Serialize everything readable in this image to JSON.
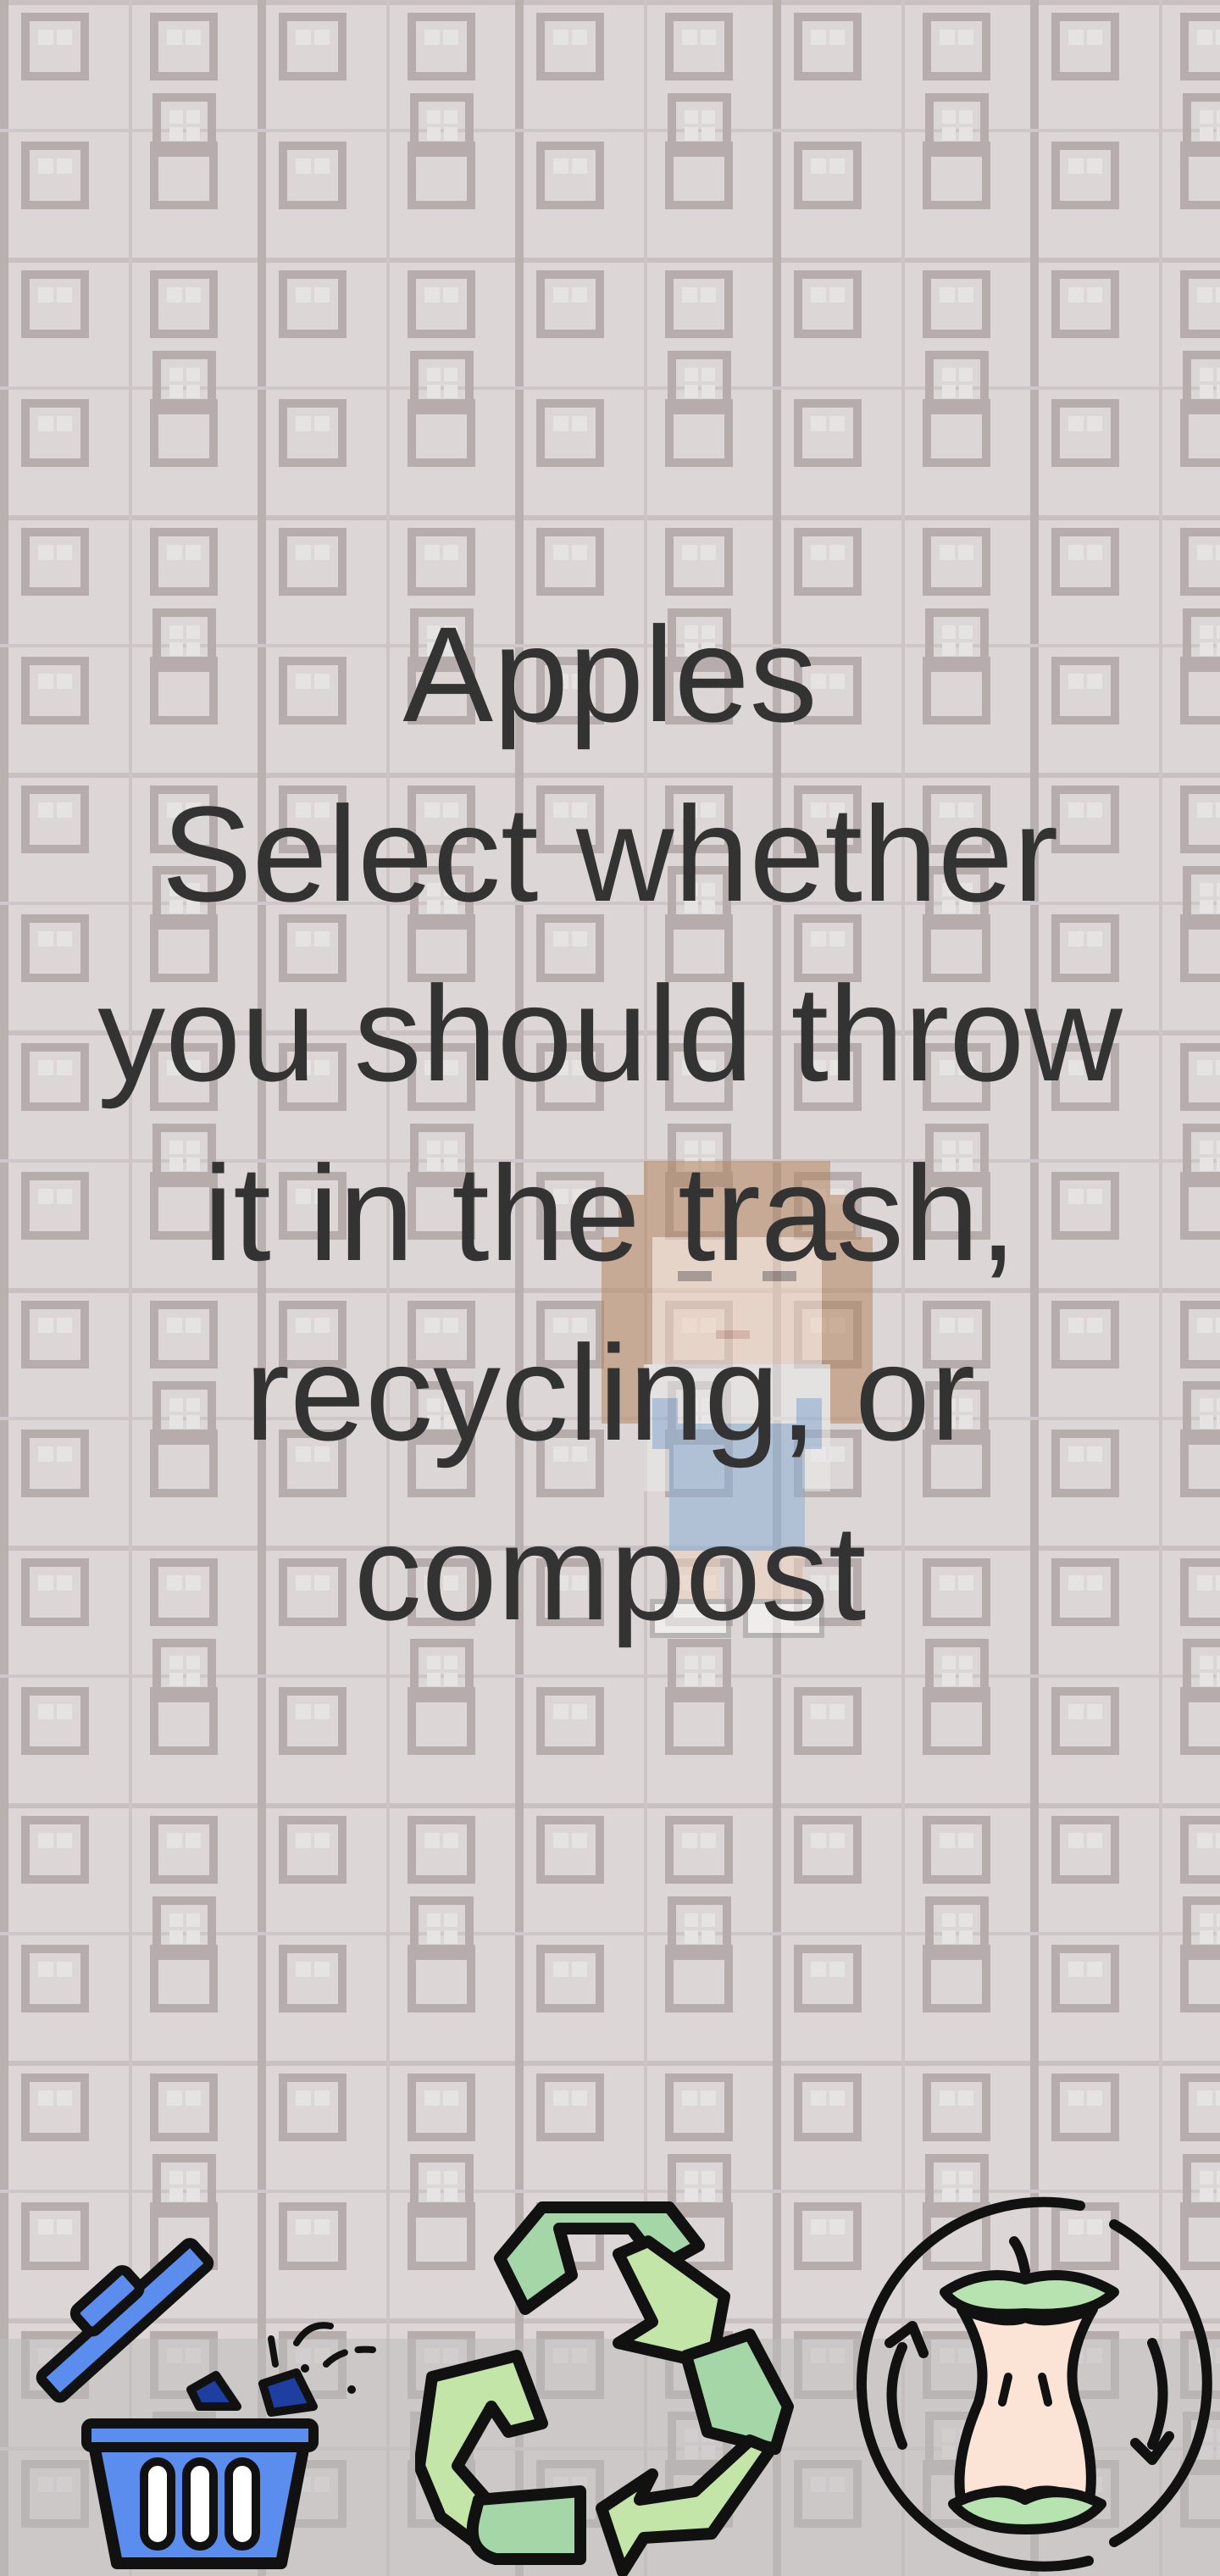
{
  "prompt": {
    "item_name": "Apples",
    "instruction_lines": [
      "Select whether",
      "you should throw",
      "it in the trash,",
      "recycling, or",
      "compost"
    ]
  },
  "choices": [
    {
      "id": "trash",
      "icon": "trash-can-icon",
      "color": "#5b8def"
    },
    {
      "id": "recycling",
      "icon": "recycle-icon",
      "color": "#a8d8a8"
    },
    {
      "id": "compost",
      "icon": "apple-core-compost-icon",
      "color": "#b6e3b0"
    }
  ],
  "colors": {
    "floor": "#ddd6d6",
    "floor_grout": "#b3a9a9",
    "text": "#333333",
    "trash_blue": "#5b8def",
    "recycle_green_light": "#c3e6a8",
    "recycle_green_dark": "#a5d6a7",
    "apple_flesh": "#fbe3d6"
  }
}
